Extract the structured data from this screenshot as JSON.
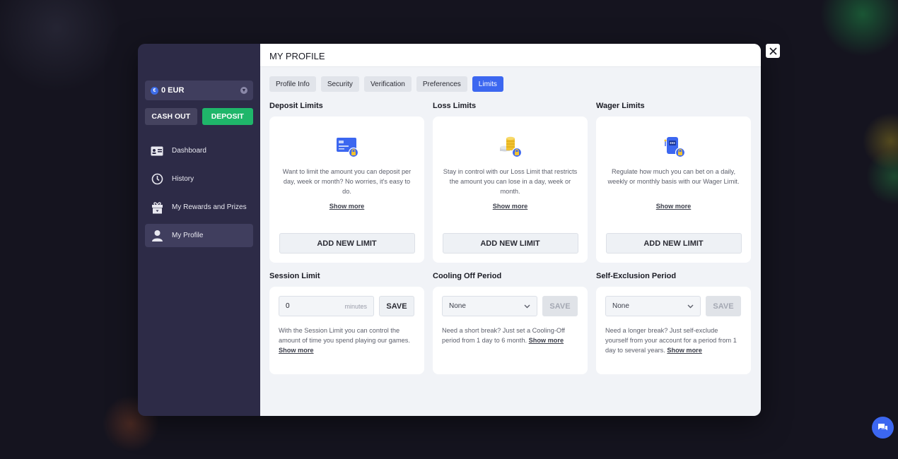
{
  "sidebar": {
    "balance": "0 EUR",
    "currency_symbol": "€",
    "cash_out_label": "CASH OUT",
    "deposit_label": "DEPOSIT",
    "items": [
      {
        "label": "Dashboard",
        "icon": "dashboard-card-icon"
      },
      {
        "label": "History",
        "icon": "clock-icon"
      },
      {
        "label": "My Rewards and Prizes",
        "icon": "gift-icon"
      },
      {
        "label": "My Profile",
        "icon": "user-icon",
        "active": true
      }
    ]
  },
  "header": {
    "title": "MY PROFILE"
  },
  "tabs": [
    {
      "label": "Profile Info"
    },
    {
      "label": "Security"
    },
    {
      "label": "Verification"
    },
    {
      "label": "Preferences"
    },
    {
      "label": "Limits",
      "active": true
    }
  ],
  "limits": [
    {
      "title": "Deposit Limits",
      "icon": "credit-card-lock-icon",
      "description": "Want to limit the amount you can deposit per day, week or month? No worries, it's easy to do.",
      "show_more": "Show more",
      "button": "ADD NEW LIMIT"
    },
    {
      "title": "Loss Limits",
      "icon": "coins-lock-icon",
      "description": "Stay in control with our Loss Limit that restricts the amount you can lose in a day, week or month.",
      "show_more": "Show more",
      "button": "ADD NEW LIMIT"
    },
    {
      "title": "Wager Limits",
      "icon": "slot-machine-lock-icon",
      "description": "Regulate how much you can bet on a daily, weekly or monthly basis with our Wager Limit.",
      "show_more": "Show more",
      "button": "ADD NEW LIMIT"
    }
  ],
  "session": {
    "title": "Session Limit",
    "value": "0",
    "unit": "minutes",
    "save": "SAVE",
    "description": "With the Session Limit you can control the amount of time you spend playing our games.",
    "show_more": "Show more"
  },
  "cooling": {
    "title": "Cooling Off Period",
    "selected": "None",
    "save": "SAVE",
    "description": "Need a short break? Just set a Cooling-Off period from 1 day to 6 month.",
    "show_more": "Show more"
  },
  "exclusion": {
    "title": "Self-Exclusion Period",
    "selected": "None",
    "save": "SAVE",
    "description": "Need a longer break? Just self-exclude yourself from your account for a period from 1 day to several years.",
    "show_more": "Show more"
  },
  "colors": {
    "accent": "#3c67f0",
    "deposit": "#1fb66a",
    "sidebar_bg": "#2d2b47"
  }
}
